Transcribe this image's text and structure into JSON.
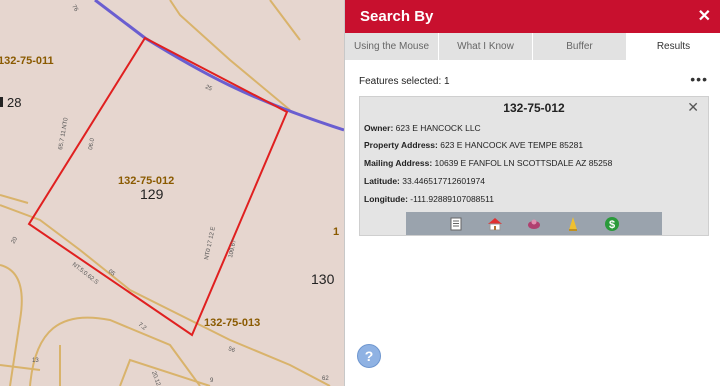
{
  "map": {
    "parcels": [
      {
        "id": "132-75-011",
        "lot": "28"
      },
      {
        "id": "132-75-012",
        "lot": "129"
      },
      {
        "id": "132-75-013",
        "lot": "130"
      }
    ],
    "dimension_labels": [
      "65.7 11.NT0",
      "06.0",
      "NT0 17 12 E",
      "109.67",
      "25",
      "NT.5:0.62.S",
      "05",
      "7.2",
      "56",
      "20",
      "13",
      "20.12",
      "62",
      "9",
      "76"
    ],
    "line_colors": {
      "selected_parcel": "#e02020",
      "road": "#6a5ed0",
      "lot_lines": "#d9b36b"
    }
  },
  "panel": {
    "title": "Search By",
    "close_symbol": "✕",
    "accent": "#c8102e",
    "tabs": [
      {
        "label": "Using the Mouse",
        "active": false
      },
      {
        "label": "What I Know",
        "active": false
      },
      {
        "label": "Buffer",
        "active": false
      },
      {
        "label": "Results",
        "active": true
      }
    ],
    "features_selected": "Features selected: 1",
    "more_symbol": "•••",
    "result": {
      "title": "132-75-012",
      "close_symbol": "✕",
      "fields": [
        {
          "label": "Owner:",
          "value": "623 E HANCOCK LLC"
        },
        {
          "label": "Property Address:",
          "value": "623 E HANCOCK AVE   TEMPE 85281"
        },
        {
          "label": "Mailing Address:",
          "value": "10639 E FANFOL LN  SCOTTSDALE AZ  85258"
        },
        {
          "label": "Latitude:",
          "value": "33.4465177126019​74"
        },
        {
          "label": "Longitude:",
          "value": "-111.92889107088511"
        }
      ],
      "actions": [
        "document-icon",
        "home-icon",
        "map-pin-icon",
        "zoom-icon",
        "dollar-icon"
      ]
    },
    "help_symbol": "?"
  }
}
